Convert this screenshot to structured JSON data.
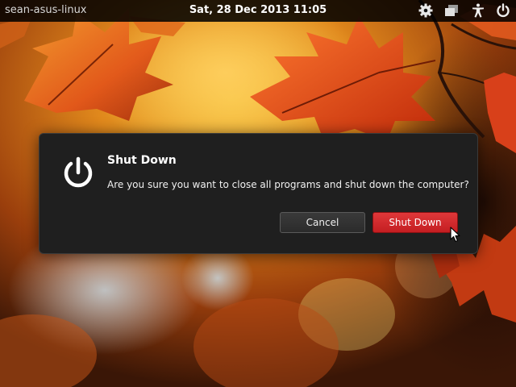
{
  "top_panel": {
    "hostname": "sean-asus-linux",
    "clock": "Sat, 28 Dec 2013 11:05",
    "tray_icons": [
      "gear-icon",
      "workspaces-icon",
      "accessibility-icon",
      "power-icon"
    ]
  },
  "dialog": {
    "icon": "power-icon",
    "title": "Shut Down",
    "message": "Are you sure you want to close all programs and shut down the computer?",
    "cancel_label": "Cancel",
    "confirm_label": "Shut Down",
    "confirm_color": "#d42a2e"
  },
  "wallpaper": {
    "description_colors": [
      "#f0a020",
      "#e05010",
      "#8a2a08",
      "#3a1a08"
    ]
  }
}
